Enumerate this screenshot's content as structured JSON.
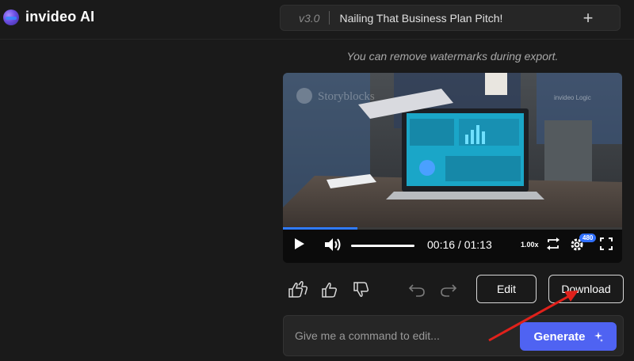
{
  "app": {
    "name": "invideo AI"
  },
  "header": {
    "version": "v3.0",
    "project_title": "Nailing That Business Plan Pitch!",
    "new_label": "+"
  },
  "notice": "You can remove watermarks during export.",
  "video": {
    "watermark_left": "Storyblocks",
    "watermark_right": "invideo Logic",
    "current_time": "00:16",
    "duration": "01:13",
    "time_display": "00:16 / 01:13",
    "speed": "1.00x",
    "quality": "480",
    "progress_fraction": 0.22,
    "volume_fraction": 1.0,
    "accent": "#2f7bff"
  },
  "actions": {
    "edit_label": "Edit",
    "download_label": "Download"
  },
  "command": {
    "placeholder": "Give me a command to edit...",
    "value": "",
    "generate_label": "Generate"
  },
  "colors": {
    "background": "#1a1a1a",
    "generate": "#4f63f2",
    "annotation_arrow": "#e0211b"
  }
}
